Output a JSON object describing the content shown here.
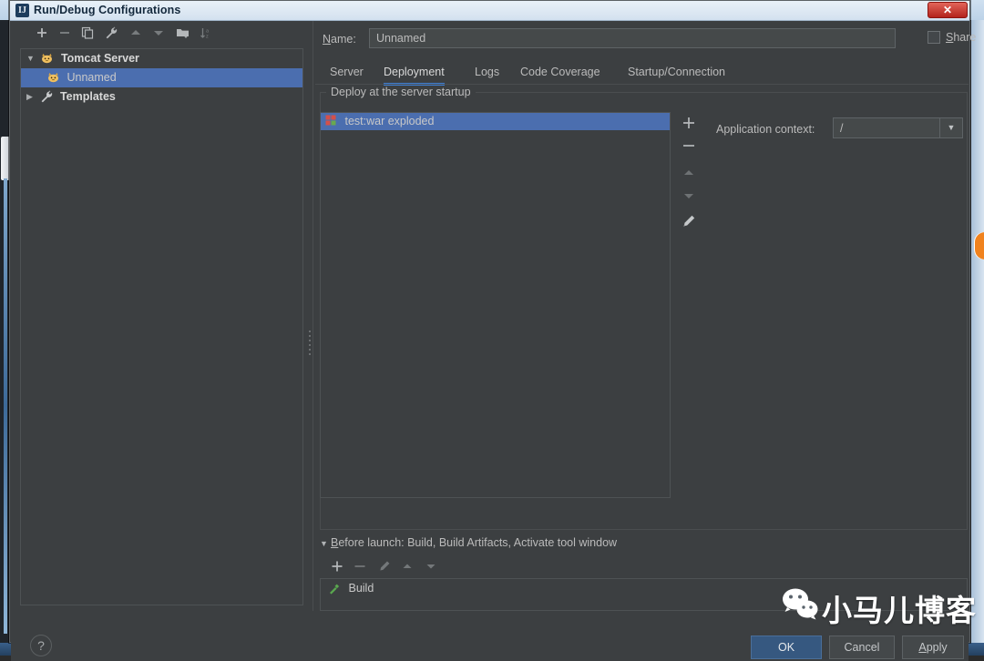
{
  "window": {
    "title": "Run/Debug Configurations",
    "app_icon": "idea-icon",
    "close_label": "✕"
  },
  "left_panel": {
    "toolbar": [
      {
        "name": "add-configuration-button",
        "icon": "plus-icon",
        "enabled": true
      },
      {
        "name": "remove-configuration-button",
        "icon": "minus-icon",
        "enabled": false
      },
      {
        "name": "copy-configuration-button",
        "icon": "copy-icon",
        "enabled": true
      },
      {
        "name": "edit-templates-button",
        "icon": "wrench-icon",
        "enabled": true
      },
      {
        "name": "move-up-button",
        "icon": "arrow-up-icon",
        "enabled": false
      },
      {
        "name": "move-down-button",
        "icon": "arrow-down-icon",
        "enabled": false
      },
      {
        "name": "create-folder-button",
        "icon": "folder-add-icon",
        "enabled": true
      },
      {
        "name": "sort-configurations-button",
        "icon": "sort-az-icon",
        "enabled": false
      }
    ],
    "tree": [
      {
        "label": "Tomcat Server",
        "icon": "tomcat-icon",
        "arrow": "▼",
        "level": 0,
        "selected": false
      },
      {
        "label": "Unnamed",
        "icon": "tomcat-icon",
        "arrow": "",
        "level": 1,
        "selected": true
      },
      {
        "label": "Templates",
        "icon": "wrench-icon",
        "arrow": "▶",
        "level": 0,
        "selected": false
      }
    ]
  },
  "right_panel": {
    "name_label": "Name:",
    "name_label_mnemonic": "N",
    "name_value": "Unnamed",
    "share_label": "Share",
    "share_label_mnemonic": "S",
    "share_checked": false,
    "tabs": [
      {
        "label": "Server",
        "active": false
      },
      {
        "label": "Deployment",
        "active": true
      },
      {
        "label": "Logs",
        "active": false
      },
      {
        "label": "Code Coverage",
        "active": false
      },
      {
        "label": "Startup/Connection",
        "active": false
      }
    ],
    "deployment": {
      "legend": "Deploy at the server startup",
      "items": [
        {
          "label": "test:war exploded",
          "icon": "artifact-icon",
          "selected": true
        }
      ],
      "list_toolbar": [
        {
          "name": "add-artifact-button",
          "icon": "plus-icon",
          "enabled": true
        },
        {
          "name": "remove-artifact-button",
          "icon": "minus-icon",
          "enabled": true
        },
        {
          "name": "move-artifact-up-button",
          "icon": "arrow-up-icon",
          "enabled": false
        },
        {
          "name": "move-artifact-down-button",
          "icon": "arrow-down-icon",
          "enabled": false
        },
        {
          "name": "edit-artifact-button",
          "icon": "pencil-icon",
          "enabled": true
        }
      ],
      "app_context_label": "Application context:",
      "app_context_value": "/",
      "app_context_arrow": "▼"
    },
    "before_launch": {
      "caret": "▼",
      "header": "Before launch: Build, Build Artifacts, Activate tool window",
      "header_mnemonic": "B",
      "toolbar": [
        {
          "name": "add-task-button",
          "icon": "plus-icon",
          "enabled": true
        },
        {
          "name": "remove-task-button",
          "icon": "minus-icon",
          "enabled": false
        },
        {
          "name": "edit-task-button",
          "icon": "pencil-icon",
          "enabled": false
        },
        {
          "name": "move-task-up-button",
          "icon": "arrow-up-icon",
          "enabled": false
        },
        {
          "name": "move-task-down-button",
          "icon": "arrow-down-icon",
          "enabled": false
        }
      ],
      "tasks": [
        {
          "label": "Build",
          "icon": "hammer-icon"
        }
      ]
    }
  },
  "footer": {
    "help_label": "?",
    "ok_label": "OK",
    "cancel_label": "Cancel",
    "apply_label": "Apply"
  },
  "watermark": {
    "text": "小马儿博客",
    "logo": "wechat-icon"
  },
  "colors": {
    "accent": "#4b6eaf",
    "tab_underline": "#3d7fd5",
    "panel_bg": "#3c3f41",
    "ok_button": "#365880",
    "close_button": "#b3231c"
  }
}
